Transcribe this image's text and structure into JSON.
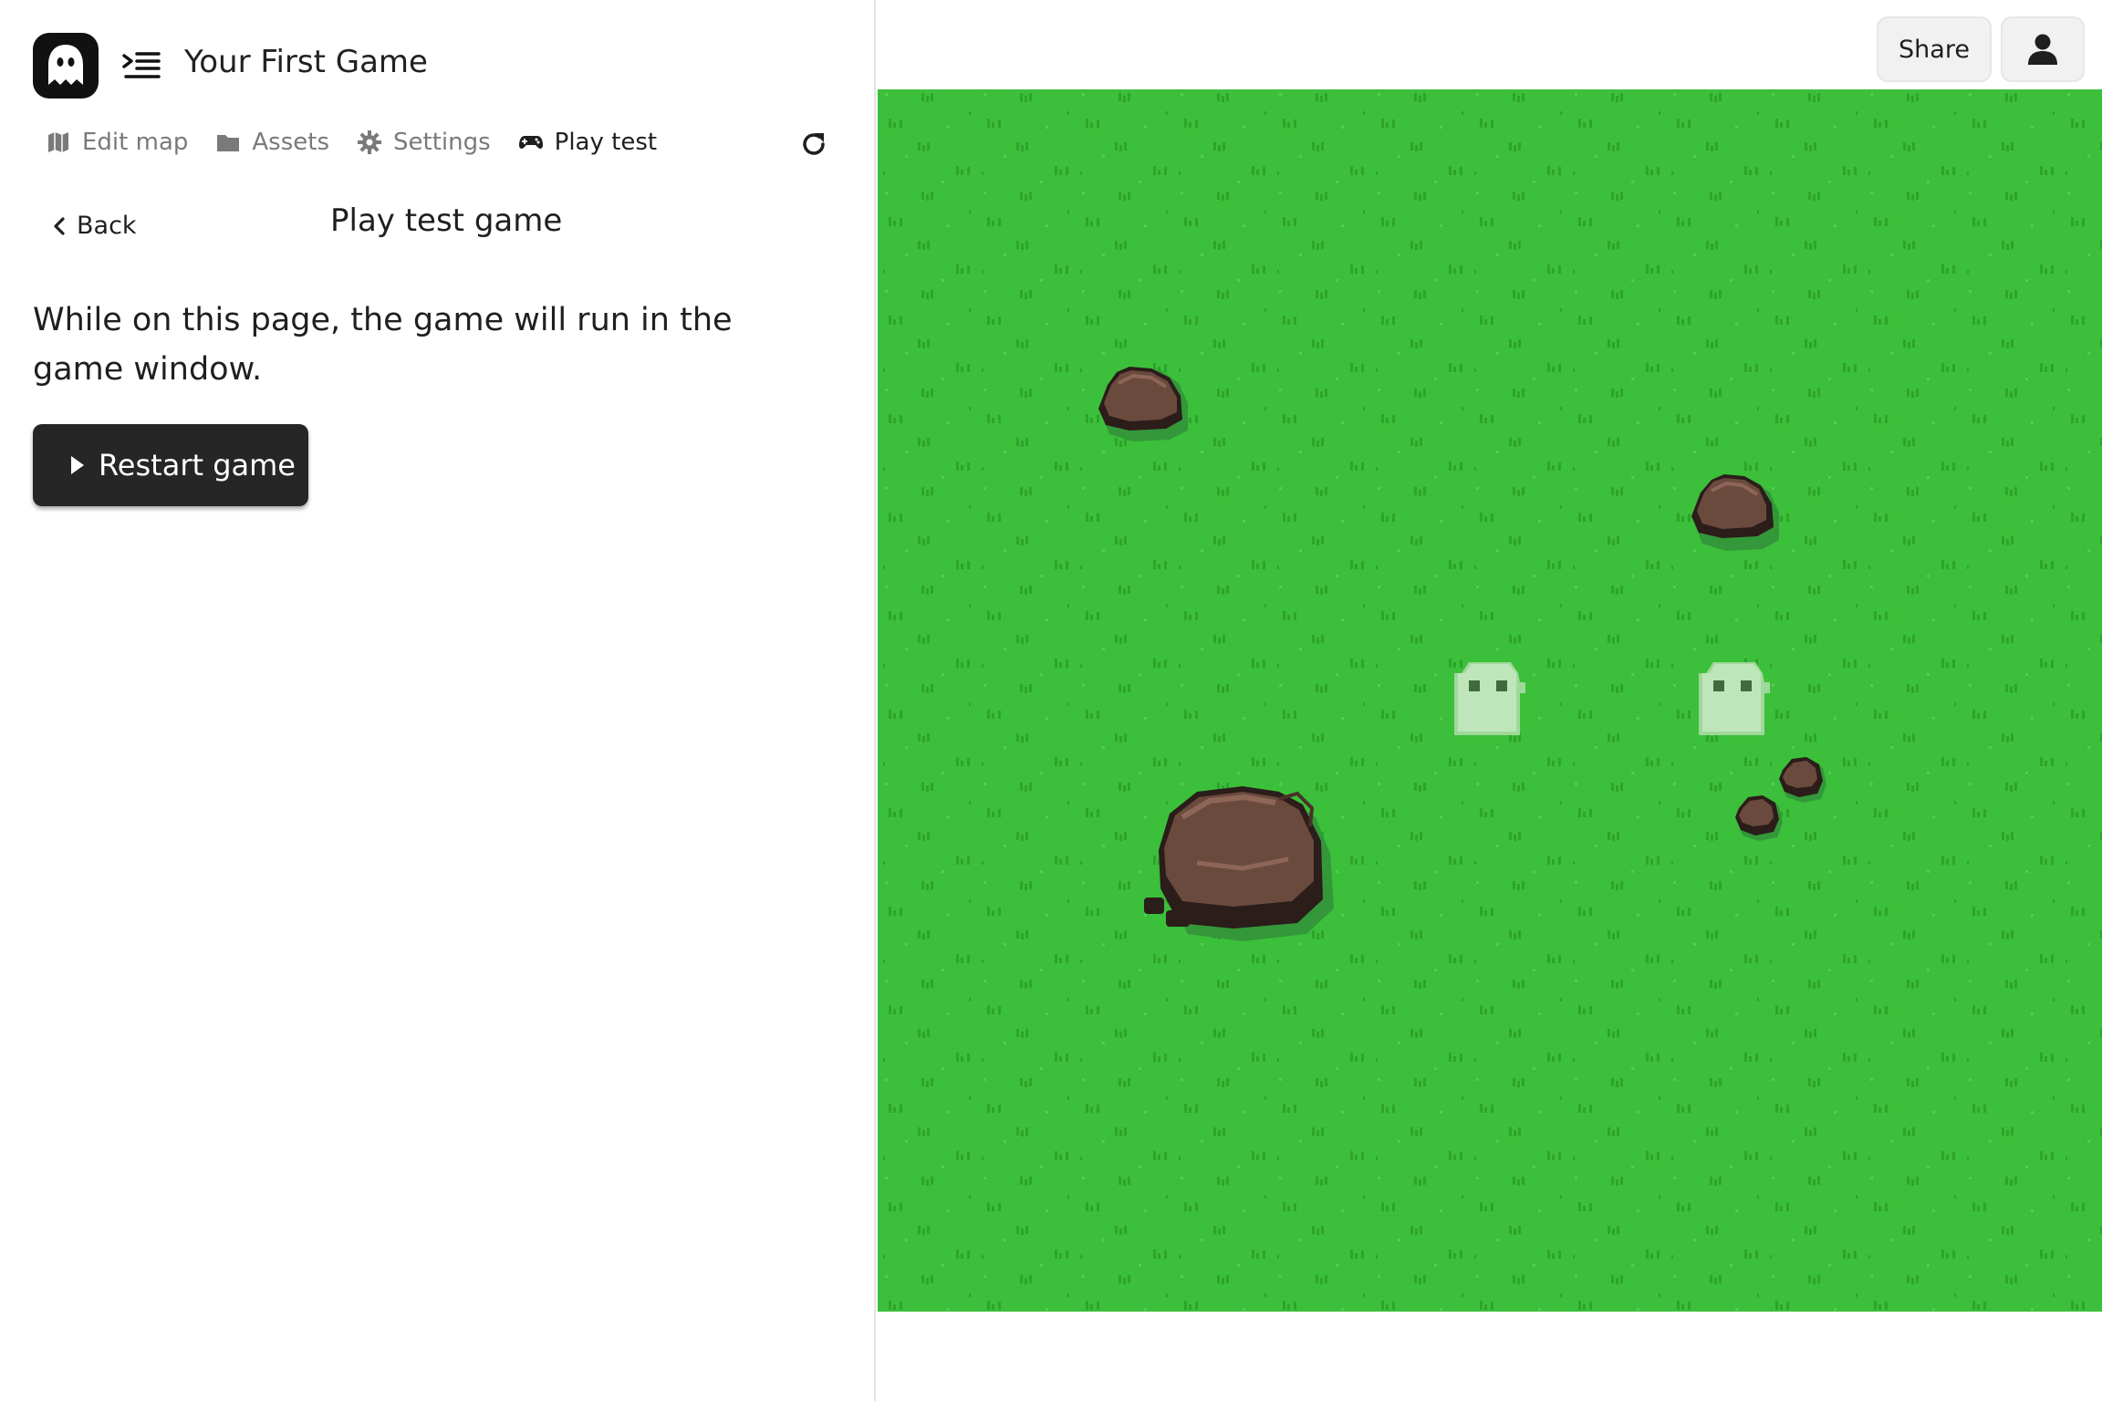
{
  "app": {
    "title": "Your First Game"
  },
  "tabs": [
    {
      "label": "Edit map",
      "icon": "map-icon"
    },
    {
      "label": "Assets",
      "icon": "folder-icon"
    },
    {
      "label": "Settings",
      "icon": "gear-icon"
    },
    {
      "label": "Play test",
      "icon": "gamepad-icon",
      "active": true
    }
  ],
  "page": {
    "back_label": "Back",
    "title": "Play test game",
    "description": "While on this page, the game will run in the game window.",
    "restart_label": "Restart game"
  },
  "header": {
    "share_label": "Share",
    "user_icon": "user-icon"
  },
  "game": {
    "background": "grass",
    "colors": {
      "grass": "#3cbf3a",
      "grass_tuft": "#2ea42c",
      "rock": "#6b4a3e",
      "ghost": "#b9e3b5"
    },
    "sprites": [
      "rock",
      "rock",
      "rock",
      "rock",
      "rock",
      "ghost",
      "ghost"
    ]
  }
}
